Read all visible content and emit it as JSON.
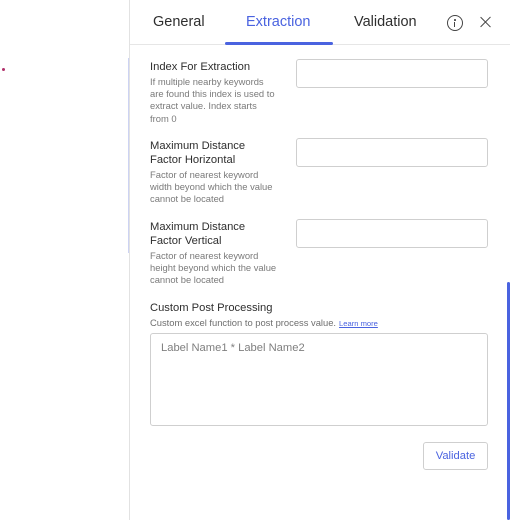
{
  "tabs": {
    "general": "General",
    "extraction": "Extraction",
    "validation": "Validation",
    "active": "Extraction"
  },
  "header_icons": [
    "info-icon",
    "close-icon"
  ],
  "fields": {
    "index": {
      "title": "Index For Extraction",
      "description": "If multiple nearby keywords are found this index is used to extract value. Index starts from 0",
      "value": ""
    },
    "horizontal": {
      "title": "Maximum Distance Factor Horizontal",
      "description": "Factor of nearest keyword width beyond which the value cannot be located",
      "value": ""
    },
    "vertical": {
      "title": "Maximum Distance Factor Vertical",
      "description": "Factor of nearest keyword height beyond which the value cannot be located",
      "value": ""
    },
    "post_processing": {
      "title": "Custom Post Processing",
      "description": "Custom excel function to post process value.",
      "learn_more": "Learn more",
      "placeholder": "Label Name1 * Label Name2",
      "value": ""
    }
  },
  "validate_label": "Validate",
  "colors": {
    "accent": "#4a63e0",
    "text": "#2e2e2e",
    "muted": "#7a7a7a",
    "border": "#cfcfcf"
  }
}
